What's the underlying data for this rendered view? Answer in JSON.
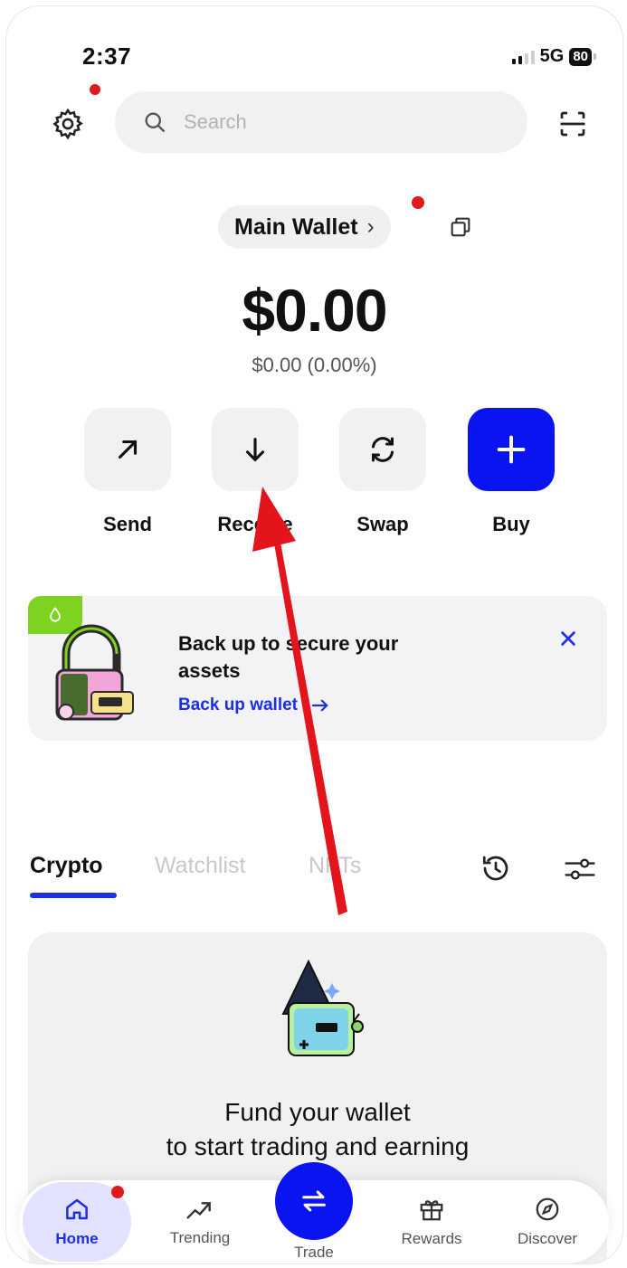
{
  "status_bar": {
    "time": "2:37",
    "network": "5G",
    "battery": "80"
  },
  "header": {
    "settings_icon": "gear-icon",
    "search_placeholder": "Search",
    "scan_icon": "scan-icon"
  },
  "wallet": {
    "name": "Main Wallet",
    "chevron": "›",
    "balance": "$0.00",
    "change": "$0.00 (0.00%)"
  },
  "actions": [
    {
      "label": "Send",
      "icon": "arrow-up-right-icon"
    },
    {
      "label": "Receive",
      "icon": "arrow-down-icon"
    },
    {
      "label": "Swap",
      "icon": "swap-icon"
    },
    {
      "label": "Buy",
      "icon": "plus-icon"
    }
  ],
  "backup_banner": {
    "title": "Back up to secure your assets",
    "link": "Back up wallet",
    "close_icon": "close-icon"
  },
  "tabs": [
    {
      "label": "Crypto",
      "active": true
    },
    {
      "label": "Watchlist",
      "active": false
    },
    {
      "label": "NFTs",
      "active": false
    }
  ],
  "empty_state": {
    "line1": "Fund your wallet",
    "line2": "to start trading and earning"
  },
  "bottom_nav": [
    {
      "label": "Home",
      "icon": "home-icon",
      "active": true
    },
    {
      "label": "Trending",
      "icon": "trending-icon",
      "active": false
    },
    {
      "label": "Trade",
      "icon": "swap-arrows-icon",
      "active": false
    },
    {
      "label": "Rewards",
      "icon": "gift-icon",
      "active": false
    },
    {
      "label": "Discover",
      "icon": "compass-icon",
      "active": false
    }
  ],
  "colors": {
    "accent": "#0a14f0",
    "link": "#1b2ee8",
    "notification": "#e01a1a",
    "annotation_arrow": "#e3141b",
    "banner_badge": "#7ed321"
  }
}
